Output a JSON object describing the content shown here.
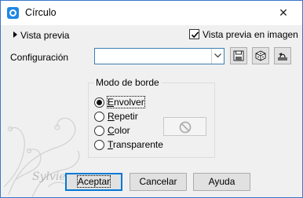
{
  "window": {
    "title": "Círculo",
    "close_glyph": "✕",
    "app_icon": "circle-app-icon"
  },
  "preview": {
    "toggle_label": "Vista previa",
    "image_preview_label": "Vista previa en imagen",
    "image_preview_checked": true
  },
  "config": {
    "label": "Configuración",
    "value": "",
    "tools": [
      "save-icon",
      "randomize-dice-icon",
      "reset-icon"
    ]
  },
  "border_mode": {
    "title": "Modo de borde",
    "options": [
      {
        "label": "Envolver",
        "selected": true
      },
      {
        "label": "Repetir",
        "selected": false
      },
      {
        "label": "Color",
        "selected": false
      },
      {
        "label": "Transparente",
        "selected": false
      }
    ]
  },
  "buttons": {
    "ok": "Aceptar",
    "cancel": "Cancelar",
    "help": "Ayuda"
  },
  "watermark": {
    "signature": "Sylvie"
  },
  "colors": {
    "window_bg": "#f0f0f0",
    "accent": "#0078d7",
    "app_icon": "#1e88e5"
  }
}
